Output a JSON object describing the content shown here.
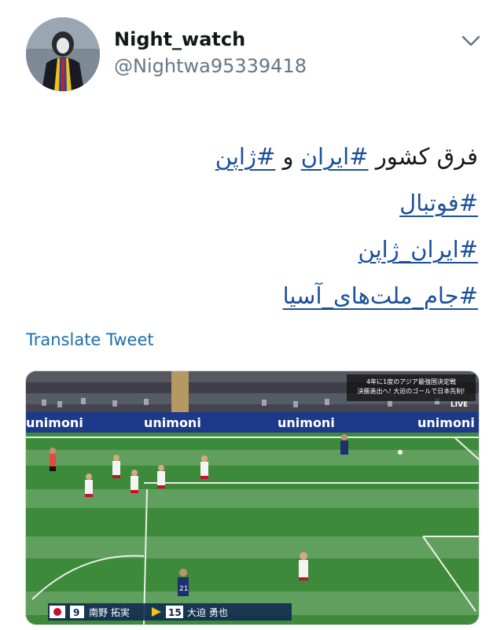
{
  "user": {
    "display_name": "Night_watch",
    "handle": "@Nightwa95339418"
  },
  "tweet": {
    "line1_text": "فرق کشور ",
    "line1_tag1": "#ایران",
    "line1_mid": " و ",
    "line1_tag2": "#ژاپن",
    "tag_line2": "#فوتبال",
    "tag_line3": "#ایران_ژاپن",
    "tag_line4": "#جام_ملت‌های_آسیا"
  },
  "translate_label": "Translate Tweet",
  "media": {
    "banner_text": "unimoni",
    "overlay_line1": "4年に1度のアジア最強国決定戦",
    "overlay_line2": "決勝進出へ! 大迫のゴールで日本先制!",
    "live_label": "LIVE",
    "player1_number": "9",
    "player1_name": "南野 拓実",
    "player2_number": "15",
    "player2_name": "大迫 勇也"
  },
  "colors": {
    "hashtag": "#1b4f9c",
    "link": "#1b6fa8",
    "pitch": "#3d8a3a",
    "banner": "#1d3a8a"
  },
  "icons": [
    "chevron-down-icon"
  ]
}
